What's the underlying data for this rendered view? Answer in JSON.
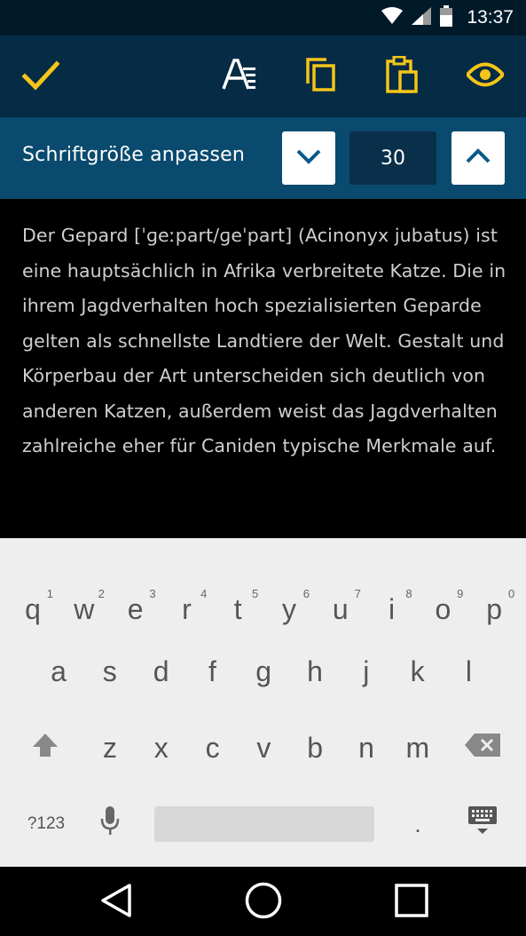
{
  "status_bar": {
    "time": "13:37"
  },
  "toolbar": {
    "buttons": [
      "confirm-check",
      "text-format",
      "copy",
      "paste",
      "preview-eye"
    ]
  },
  "font_size_bar": {
    "label": "Schriftgröße anpassen",
    "value": "30"
  },
  "content": {
    "text": "Der Gepard [ˈɡeːpart/ɡeˈpart] (Acinonyx jubatus) ist eine hauptsächlich in Afrika verbreitete Katze. Die in ihrem Jagdverhalten hoch spezialisierten Geparde gelten als schnellste Landtiere der Welt. Gestalt und Körperbau der Art unterscheiden sich deutlich von anderen Katzen, außerdem weist das Jagdverhalten zahlreiche eher für Caniden typische Merkmale auf."
  },
  "keyboard": {
    "row1": [
      {
        "char": "q",
        "hint": "1"
      },
      {
        "char": "w",
        "hint": "2"
      },
      {
        "char": "e",
        "hint": "3"
      },
      {
        "char": "r",
        "hint": "4"
      },
      {
        "char": "t",
        "hint": "5"
      },
      {
        "char": "y",
        "hint": "6"
      },
      {
        "char": "u",
        "hint": "7"
      },
      {
        "char": "i",
        "hint": "8"
      },
      {
        "char": "o",
        "hint": "9"
      },
      {
        "char": "p",
        "hint": "0"
      }
    ],
    "row2": [
      "a",
      "s",
      "d",
      "f",
      "g",
      "h",
      "j",
      "k",
      "l"
    ],
    "row3": [
      "z",
      "x",
      "c",
      "v",
      "b",
      "n",
      "m"
    ],
    "symbols_label": "?123",
    "period": "."
  },
  "colors": {
    "accent": "#f5c518",
    "toolbar_bg": "#052b45",
    "fontbar_bg": "#0a4a6e",
    "status_bg": "#001a2a"
  }
}
